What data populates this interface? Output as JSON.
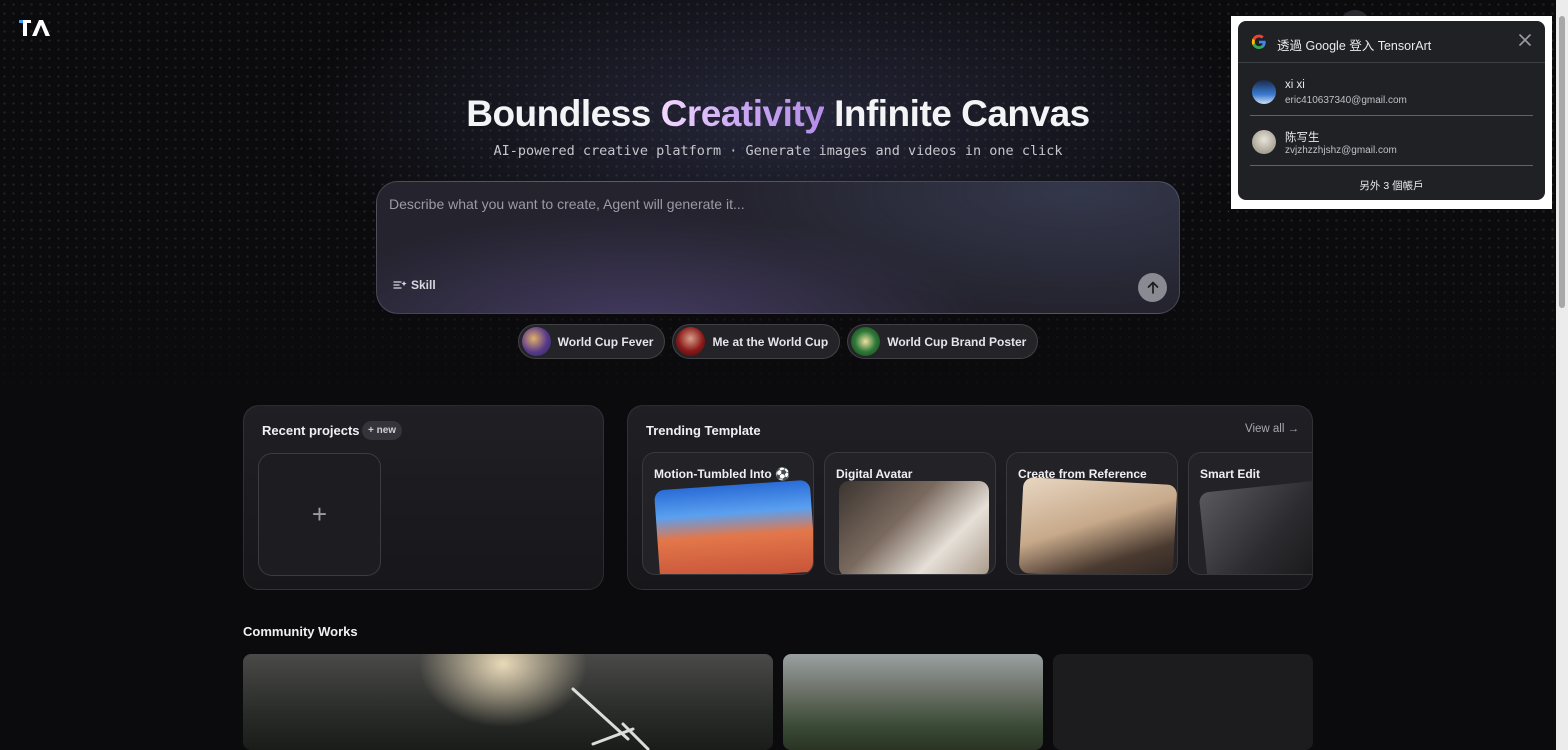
{
  "hero": {
    "title_part1": "Boundless ",
    "title_accent": "Creativity",
    "title_part2": " Infinite Canvas",
    "subtitle": "AI-powered creative platform · Generate images and videos in one click"
  },
  "prompt": {
    "placeholder": "Describe what you want to create, Agent will generate it...",
    "value": "",
    "skill_label": "Skill"
  },
  "chips": [
    {
      "label": "World Cup Fever"
    },
    {
      "label": "Me at the World Cup"
    },
    {
      "label": "World Cup Brand Poster"
    }
  ],
  "recent": {
    "title": "Recent projects",
    "new_badge": "+ new",
    "add_symbol": "+"
  },
  "trending": {
    "title": "Trending Template",
    "view_all": "View all →",
    "templates": [
      {
        "label": "Motion-Tumbled Into ⚽"
      },
      {
        "label": "Digital Avatar"
      },
      {
        "label": "Create from Reference"
      },
      {
        "label": "Smart Edit"
      }
    ]
  },
  "community": {
    "title": "Community Works"
  },
  "google_popup": {
    "title": "透過 Google 登入 TensorArt",
    "accounts": [
      {
        "name": "xi xi",
        "email": "eric410637340@gmail.com"
      },
      {
        "name": "陈写生",
        "email": "zvjzhzzhjshz@gmail.com"
      }
    ],
    "more_accounts": "另外 3 個帳戶"
  },
  "colors": {
    "background": "#0b0b0d",
    "accent_gradient_start": "#f3d8ff",
    "accent_gradient_end": "#b58ee8",
    "popup_bg": "#202124"
  },
  "icons": {
    "logo": "tensorart-logo",
    "skill": "skill-sparkle-icon",
    "send": "arrow-up-icon",
    "close": "close-icon",
    "google": "google-g-icon"
  }
}
